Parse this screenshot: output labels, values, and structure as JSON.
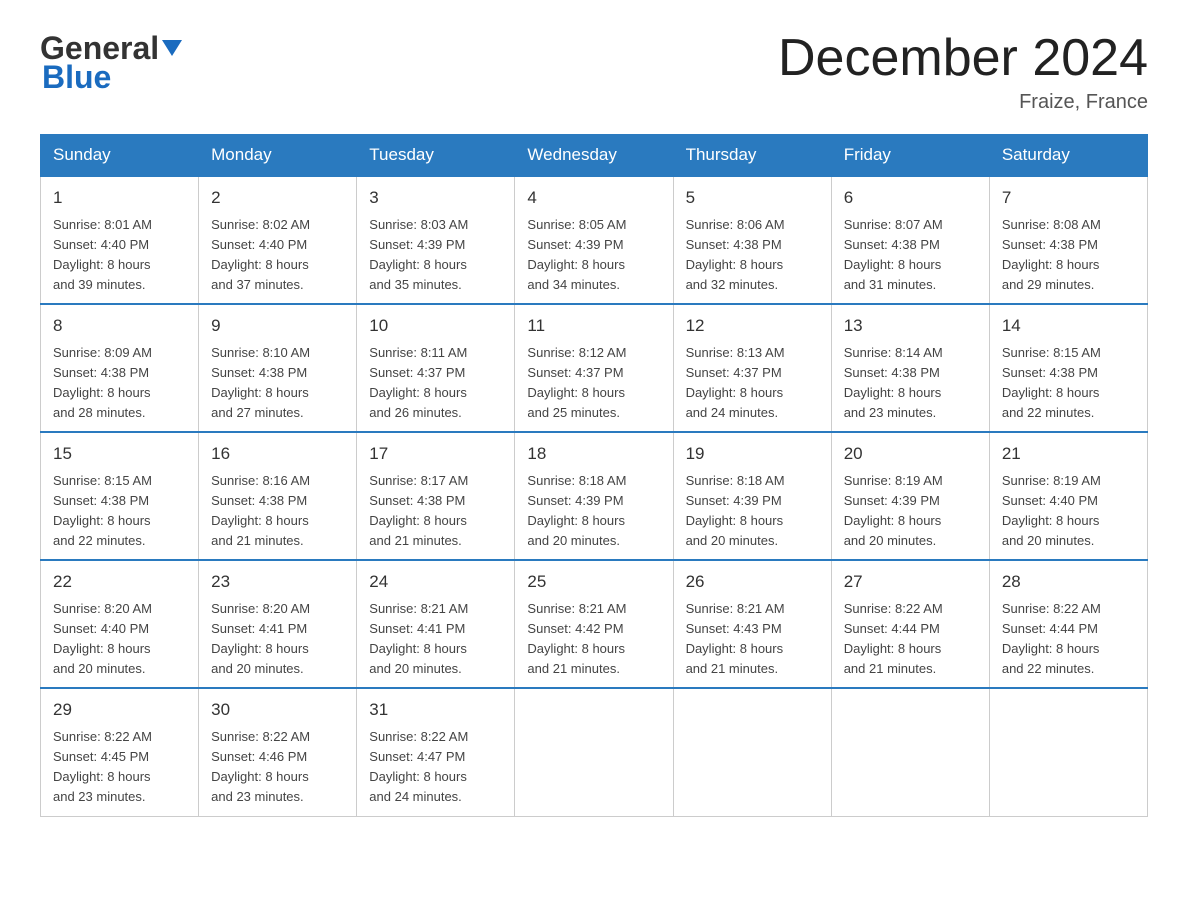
{
  "header": {
    "logo_general": "General",
    "logo_blue": "Blue",
    "month_title": "December 2024",
    "location": "Fraize, France"
  },
  "days_of_week": [
    "Sunday",
    "Monday",
    "Tuesday",
    "Wednesday",
    "Thursday",
    "Friday",
    "Saturday"
  ],
  "weeks": [
    [
      {
        "num": "1",
        "info": "Sunrise: 8:01 AM\nSunset: 4:40 PM\nDaylight: 8 hours\nand 39 minutes."
      },
      {
        "num": "2",
        "info": "Sunrise: 8:02 AM\nSunset: 4:40 PM\nDaylight: 8 hours\nand 37 minutes."
      },
      {
        "num": "3",
        "info": "Sunrise: 8:03 AM\nSunset: 4:39 PM\nDaylight: 8 hours\nand 35 minutes."
      },
      {
        "num": "4",
        "info": "Sunrise: 8:05 AM\nSunset: 4:39 PM\nDaylight: 8 hours\nand 34 minutes."
      },
      {
        "num": "5",
        "info": "Sunrise: 8:06 AM\nSunset: 4:38 PM\nDaylight: 8 hours\nand 32 minutes."
      },
      {
        "num": "6",
        "info": "Sunrise: 8:07 AM\nSunset: 4:38 PM\nDaylight: 8 hours\nand 31 minutes."
      },
      {
        "num": "7",
        "info": "Sunrise: 8:08 AM\nSunset: 4:38 PM\nDaylight: 8 hours\nand 29 minutes."
      }
    ],
    [
      {
        "num": "8",
        "info": "Sunrise: 8:09 AM\nSunset: 4:38 PM\nDaylight: 8 hours\nand 28 minutes."
      },
      {
        "num": "9",
        "info": "Sunrise: 8:10 AM\nSunset: 4:38 PM\nDaylight: 8 hours\nand 27 minutes."
      },
      {
        "num": "10",
        "info": "Sunrise: 8:11 AM\nSunset: 4:37 PM\nDaylight: 8 hours\nand 26 minutes."
      },
      {
        "num": "11",
        "info": "Sunrise: 8:12 AM\nSunset: 4:37 PM\nDaylight: 8 hours\nand 25 minutes."
      },
      {
        "num": "12",
        "info": "Sunrise: 8:13 AM\nSunset: 4:37 PM\nDaylight: 8 hours\nand 24 minutes."
      },
      {
        "num": "13",
        "info": "Sunrise: 8:14 AM\nSunset: 4:38 PM\nDaylight: 8 hours\nand 23 minutes."
      },
      {
        "num": "14",
        "info": "Sunrise: 8:15 AM\nSunset: 4:38 PM\nDaylight: 8 hours\nand 22 minutes."
      }
    ],
    [
      {
        "num": "15",
        "info": "Sunrise: 8:15 AM\nSunset: 4:38 PM\nDaylight: 8 hours\nand 22 minutes."
      },
      {
        "num": "16",
        "info": "Sunrise: 8:16 AM\nSunset: 4:38 PM\nDaylight: 8 hours\nand 21 minutes."
      },
      {
        "num": "17",
        "info": "Sunrise: 8:17 AM\nSunset: 4:38 PM\nDaylight: 8 hours\nand 21 minutes."
      },
      {
        "num": "18",
        "info": "Sunrise: 8:18 AM\nSunset: 4:39 PM\nDaylight: 8 hours\nand 20 minutes."
      },
      {
        "num": "19",
        "info": "Sunrise: 8:18 AM\nSunset: 4:39 PM\nDaylight: 8 hours\nand 20 minutes."
      },
      {
        "num": "20",
        "info": "Sunrise: 8:19 AM\nSunset: 4:39 PM\nDaylight: 8 hours\nand 20 minutes."
      },
      {
        "num": "21",
        "info": "Sunrise: 8:19 AM\nSunset: 4:40 PM\nDaylight: 8 hours\nand 20 minutes."
      }
    ],
    [
      {
        "num": "22",
        "info": "Sunrise: 8:20 AM\nSunset: 4:40 PM\nDaylight: 8 hours\nand 20 minutes."
      },
      {
        "num": "23",
        "info": "Sunrise: 8:20 AM\nSunset: 4:41 PM\nDaylight: 8 hours\nand 20 minutes."
      },
      {
        "num": "24",
        "info": "Sunrise: 8:21 AM\nSunset: 4:41 PM\nDaylight: 8 hours\nand 20 minutes."
      },
      {
        "num": "25",
        "info": "Sunrise: 8:21 AM\nSunset: 4:42 PM\nDaylight: 8 hours\nand 21 minutes."
      },
      {
        "num": "26",
        "info": "Sunrise: 8:21 AM\nSunset: 4:43 PM\nDaylight: 8 hours\nand 21 minutes."
      },
      {
        "num": "27",
        "info": "Sunrise: 8:22 AM\nSunset: 4:44 PM\nDaylight: 8 hours\nand 21 minutes."
      },
      {
        "num": "28",
        "info": "Sunrise: 8:22 AM\nSunset: 4:44 PM\nDaylight: 8 hours\nand 22 minutes."
      }
    ],
    [
      {
        "num": "29",
        "info": "Sunrise: 8:22 AM\nSunset: 4:45 PM\nDaylight: 8 hours\nand 23 minutes."
      },
      {
        "num": "30",
        "info": "Sunrise: 8:22 AM\nSunset: 4:46 PM\nDaylight: 8 hours\nand 23 minutes."
      },
      {
        "num": "31",
        "info": "Sunrise: 8:22 AM\nSunset: 4:47 PM\nDaylight: 8 hours\nand 24 minutes."
      },
      null,
      null,
      null,
      null
    ]
  ]
}
